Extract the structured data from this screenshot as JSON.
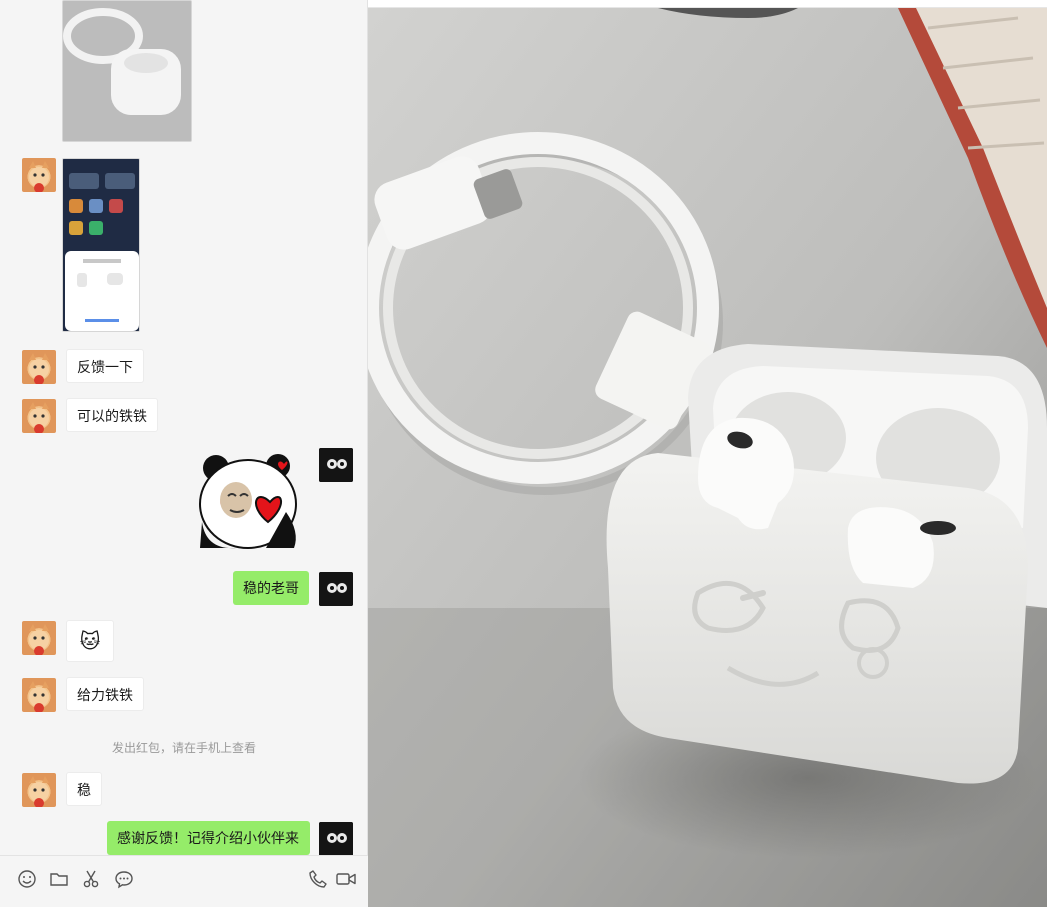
{
  "chat": {
    "messages": [
      {
        "side": "left",
        "type": "text",
        "text": "反馈一下"
      },
      {
        "side": "left",
        "type": "text",
        "text": "可以的铁铁"
      },
      {
        "side": "right",
        "type": "text",
        "text": "稳的老哥"
      },
      {
        "side": "left",
        "type": "emoji",
        "emoji": "🐱"
      },
      {
        "side": "left",
        "type": "text",
        "text": "给力铁铁"
      },
      {
        "side": "left",
        "type": "text",
        "text": "稳"
      },
      {
        "side": "right",
        "type": "text",
        "text": "感谢反馈！记得介绍小伙伴来"
      }
    ],
    "system_notice": "发出红包，请在手机上查看"
  },
  "input_bar": {
    "tools_left": [
      "emoji-icon",
      "folder-icon",
      "scissors-icon",
      "chat-history-icon"
    ],
    "tools_right": [
      "phone-icon",
      "video-call-icon"
    ]
  },
  "colors": {
    "sent_bubble": "#95ec69",
    "received_bubble": "#ffffff",
    "pane_bg": "#f5f5f5"
  }
}
